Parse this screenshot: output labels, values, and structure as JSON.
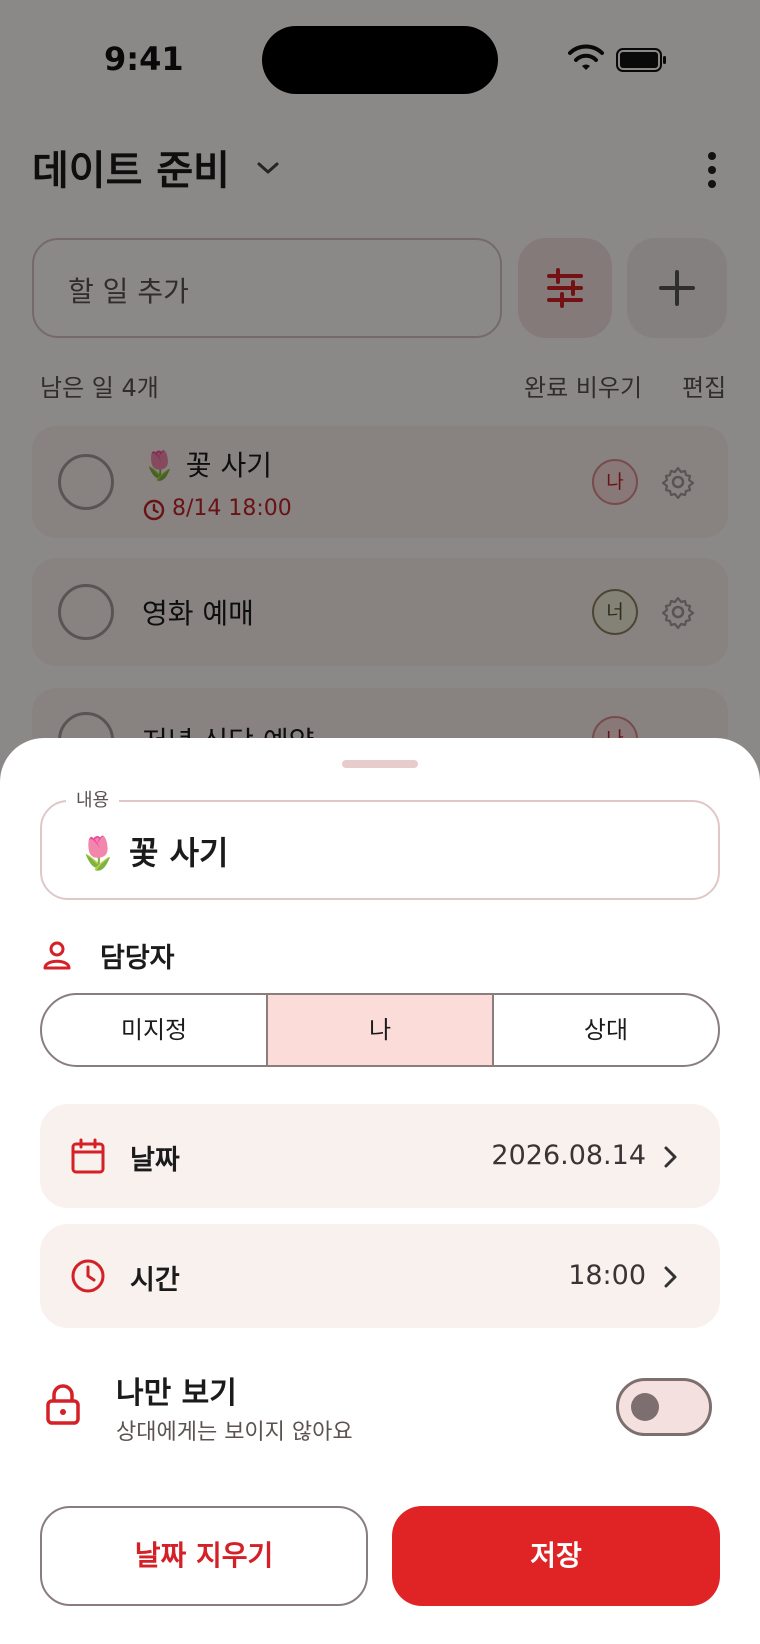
{
  "status_bar": {
    "time": "9:41"
  },
  "header": {
    "title": "데이트 준비"
  },
  "add_task": {
    "placeholder": "할 일 추가"
  },
  "list_meta": {
    "remaining": "남은 일 4개",
    "clear_done": "완료 비우기",
    "edit": "편집"
  },
  "tasks": [
    {
      "emoji": "🌷",
      "label": "꽃 사기",
      "due": "8/14 18:00",
      "assignee": "나"
    },
    {
      "label": "영화 예매",
      "assignee": "너"
    },
    {
      "label": "저녁 식당 예약",
      "assignee": "나"
    }
  ],
  "sheet": {
    "content_label": "내용",
    "content_value": "🌷 꽃 사기",
    "assignee_title": "담당자",
    "assignee_options": [
      "미지정",
      "나",
      "상대"
    ],
    "assignee_selected": "나",
    "date_label": "날짜",
    "date_value": "2026.08.14",
    "time_label": "시간",
    "time_value": "18:00",
    "private_title": "나만 보기",
    "private_sub": "상대에게는 보이지 않아요",
    "private_on": false,
    "clear_date_label": "날짜 지우기",
    "save_label": "저장"
  },
  "colors": {
    "accent": "#e02426",
    "accent_soft": "#fcdcd9",
    "surface": "#f8f1ee"
  }
}
